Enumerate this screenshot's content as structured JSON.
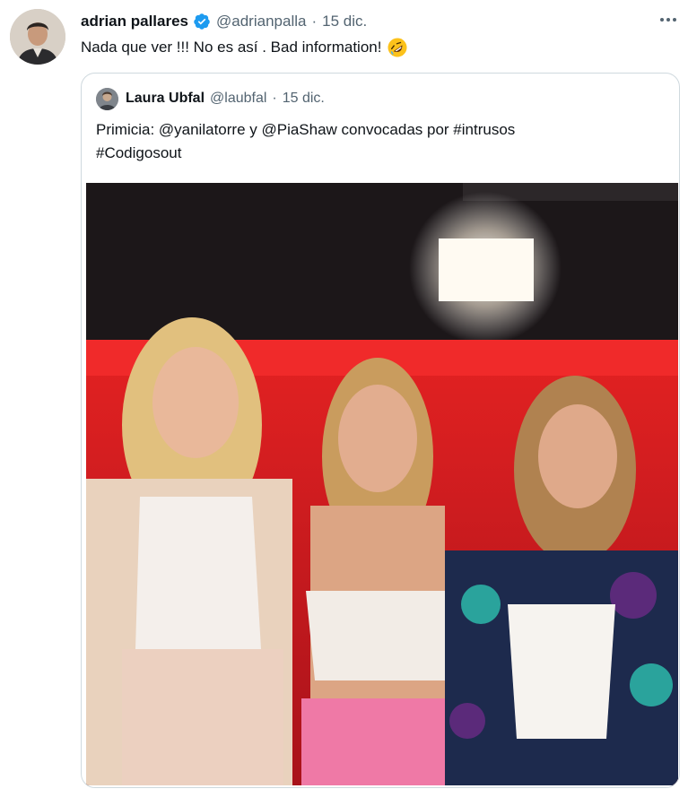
{
  "tweet": {
    "author_name": "adrian pallares",
    "author_handle": "@adrianpalla",
    "separator": "·",
    "date": "15 dic.",
    "text": "Nada que ver !!! No es así . Bad information!",
    "emoji_icon": "rolling-on-floor-laughing-emoji",
    "verified_color": "#1d9bf0"
  },
  "quoted_tweet": {
    "author_name": "Laura Ubfal",
    "author_handle": "@laubfal",
    "separator": "·",
    "date": "15 dic.",
    "text_line1": "Primicia: @yanilatorre y @PiaShaw convocadas por #intrusos",
    "text_line2": "#Codigosout"
  },
  "colors": {
    "text_primary": "#0f1419",
    "text_secondary": "#536471",
    "border": "#cfd9de",
    "studio_red": "#d81e1e"
  }
}
